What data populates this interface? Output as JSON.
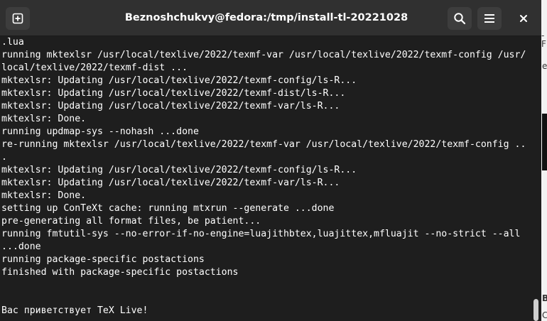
{
  "window": {
    "title": "Beznoshchukvy@fedora:/tmp/install-tl-20221028"
  },
  "header": {
    "new_tab_icon": "new-tab-icon",
    "search_icon": "search-icon",
    "menu_icon": "hamburger-menu-icon",
    "close_icon": "close-icon"
  },
  "terminal": {
    "lines": [
      ".lua",
      "running mktexlsr /usr/local/texlive/2022/texmf-var /usr/local/texlive/2022/texmf-config /usr/",
      "local/texlive/2022/texmf-dist ...",
      "mktexlsr: Updating /usr/local/texlive/2022/texmf-config/ls-R...",
      "mktexlsr: Updating /usr/local/texlive/2022/texmf-dist/ls-R...",
      "mktexlsr: Updating /usr/local/texlive/2022/texmf-var/ls-R...",
      "mktexlsr: Done.",
      "running updmap-sys --nohash ...done",
      "re-running mktexlsr /usr/local/texlive/2022/texmf-var /usr/local/texlive/2022/texmf-config ..",
      ".",
      "mktexlsr: Updating /usr/local/texlive/2022/texmf-config/ls-R...",
      "mktexlsr: Updating /usr/local/texlive/2022/texmf-var/ls-R...",
      "mktexlsr: Done.",
      "setting up ConTeXt cache: running mtxrun --generate ...done",
      "pre-generating all format files, be patient...",
      "running fmtutil-sys --no-error-if-no-engine=luajithbtex,luajittex,mfluajit --no-strict --all",
      "...done",
      "running package-specific postactions",
      "finished with package-specific postactions",
      "",
      "",
      "Вас приветствует TeX Live!"
    ]
  },
  "background": {
    "glyphs": [
      "-F",
      "e",
      "B",
      "C"
    ]
  }
}
